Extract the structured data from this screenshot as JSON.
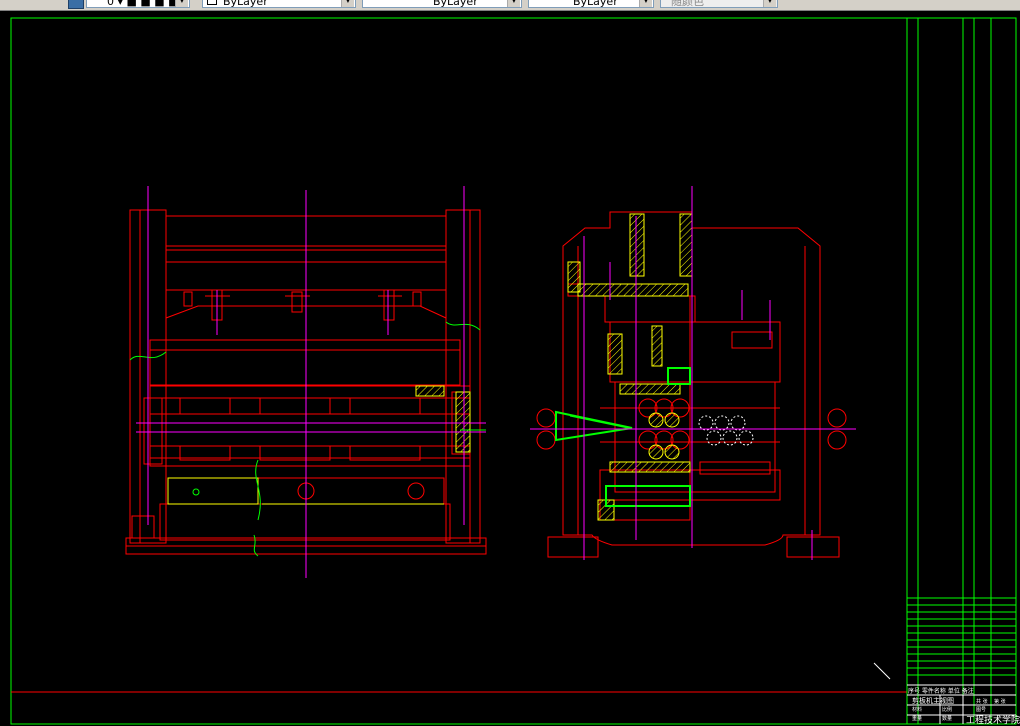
{
  "toolbar": {
    "layer_value": "0 ▾ ■ ■ ■ ■",
    "color_value": "ByLayer",
    "linetype_value": "ByLayer",
    "lineweight_value": "ByLayer",
    "plotstyle_value": "随颜色"
  },
  "title_block": {
    "head_row": "序号  零件名称   单位   备注",
    "drawing_name": "剪板机主视图",
    "school": "工程技术学院",
    "small_labels": [
      "比例",
      "数量",
      "材料",
      "重量",
      "共 张",
      "第 张",
      "图号"
    ]
  },
  "colors": {
    "background": "#000000",
    "frame": "#00ff00",
    "part_outline": "#ff0000",
    "center_line": "#ff00ff",
    "hatch": "#ffff00",
    "text": "#ffffff"
  },
  "icons": {
    "layer_icon": "layer-manager-icon",
    "dropdown_icon": "chevron-down-icon",
    "cursor_icon": "crosshair-cursor-icon"
  }
}
